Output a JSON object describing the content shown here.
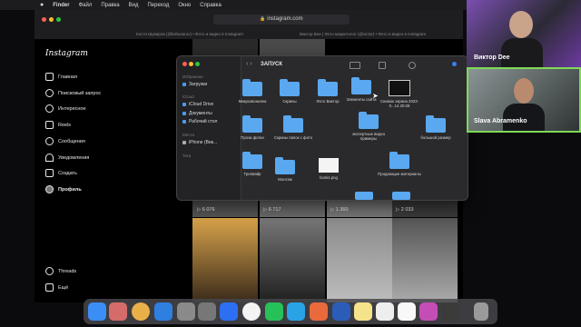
{
  "menubar": {
    "app": "Finder",
    "items": [
      "Файл",
      "Правка",
      "Вид",
      "Переход",
      "Окно",
      "Справка"
    ]
  },
  "browser": {
    "url": "instagram.com",
    "tabs": [
      "Костя Шуваров (@kshuvarov) • Фото и видео в Instagram",
      "Виктор Вне | Фото маркетолог (@victor) • Фото и видео в Instagram"
    ]
  },
  "instagram": {
    "logo": "Instagram",
    "nav": [
      "Главная",
      "Поисковый запрос",
      "Интересное",
      "Reels",
      "Сообщения",
      "Уведомления",
      "Создать",
      "Профиль"
    ],
    "bottom_nav": [
      "Threads",
      "Ещё"
    ],
    "view_counts": [
      "6 076",
      "6 717",
      "1 360",
      "2 033"
    ]
  },
  "finder": {
    "title": "ЗАПУСК",
    "sidebar": {
      "favorites_header": "Избранное",
      "favorites": [
        "Загрузки"
      ],
      "icloud_header": "iCloud",
      "icloud": [
        "iCloud Drive",
        "Документы",
        "Рабочий стол"
      ],
      "places_header": "Места",
      "places": [
        "iPhone (Вик..."
      ],
      "tags_header": "Теги"
    },
    "items": [
      {
        "label": "Микрозвонилка",
        "kind": "folder"
      },
      {
        "label": "Скрины",
        "kind": "folder"
      },
      {
        "label": "Фото Виктор",
        "kind": "folder"
      },
      {
        "label": "Элементы сайта",
        "kind": "folder"
      },
      {
        "label": "Снимок экрана 2023-0...14.20.08",
        "kind": "image"
      },
      {
        "label": "Проза фотки",
        "kind": "folder"
      },
      {
        "label": "Скрины папок с фото",
        "kind": "folder"
      },
      {
        "label": "экспертные видео примеры",
        "kind": "folder"
      },
      {
        "label": "большой размер",
        "kind": "folder"
      },
      {
        "label": "Трипвайр",
        "kind": "folder"
      },
      {
        "label": "Монтаж",
        "kind": "folder"
      },
      {
        "label": "bonks.png",
        "kind": "file"
      },
      {
        "label": "Продающие материалы",
        "kind": "folder"
      }
    ]
  },
  "video": {
    "participant1": "Виктор Dee",
    "participant2": "Slava Abramenko"
  }
}
